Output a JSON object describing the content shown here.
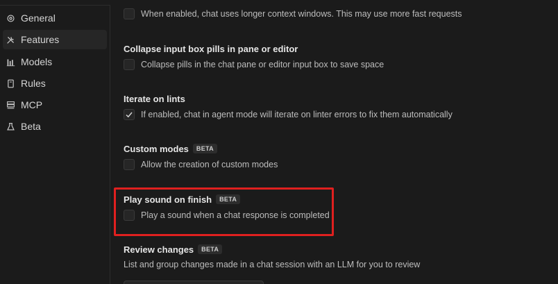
{
  "sidebar": {
    "items": [
      {
        "label": "General",
        "icon": "gear-icon"
      },
      {
        "label": "Features",
        "icon": "tools-icon"
      },
      {
        "label": "Models",
        "icon": "bar-chart-icon"
      },
      {
        "label": "Rules",
        "icon": "document-icon"
      },
      {
        "label": "MCP",
        "icon": "server-icon"
      },
      {
        "label": "Beta",
        "icon": "flask-icon"
      }
    ],
    "active": "Features"
  },
  "settings": {
    "long_context": {
      "description": "When enabled, chat uses longer context windows. This may use more fast requests",
      "checked": false
    },
    "collapse_pills": {
      "title": "Collapse input box pills in pane or editor",
      "description": "Collapse pills in the chat pane or editor input box to save space",
      "checked": false
    },
    "iterate_lints": {
      "title": "Iterate on lints",
      "description": "If enabled, chat in agent mode will iterate on linter errors to fix them automatically",
      "checked": true
    },
    "custom_modes": {
      "title": "Custom modes",
      "badge": "BETA",
      "description": "Allow the creation of custom modes",
      "checked": false
    },
    "play_sound": {
      "title": "Play sound on finish",
      "badge": "BETA",
      "description": "Play a sound when a chat response is completed",
      "checked": false
    },
    "review_changes": {
      "title": "Review changes",
      "badge": "BETA",
      "description": "List and group changes made in a chat session with an LLM for you to review"
    }
  },
  "colors": {
    "background": "#1b1b1b",
    "highlight": "#e0201f",
    "checkbox_bg": "#262626"
  }
}
